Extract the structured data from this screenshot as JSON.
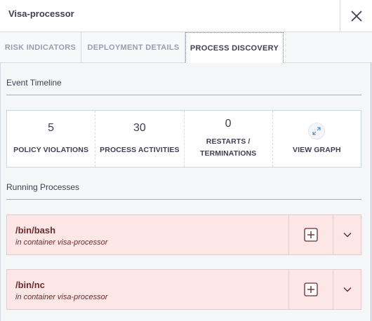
{
  "header": {
    "title": "Visa-processor",
    "close_icon": "close-icon"
  },
  "tabs": [
    {
      "label": "RISK INDICATORS",
      "active": false
    },
    {
      "label": "DEPLOYMENT DETAILS",
      "active": false
    },
    {
      "label": "PROCESS DISCOVERY",
      "active": true
    }
  ],
  "event_timeline": {
    "title": "Event Timeline",
    "stats": [
      {
        "value": "5",
        "label": "POLICY VIOLATIONS"
      },
      {
        "value": "30",
        "label": "PROCESS ACTIVITIES"
      },
      {
        "value": "0",
        "label_line1": "RESTARTS /",
        "label_line2": "TERMINATIONS"
      },
      {
        "icon": "expand-icon",
        "label": "VIEW GRAPH"
      }
    ]
  },
  "running_processes": {
    "title": "Running Processes",
    "items": [
      {
        "name": "/bin/bash",
        "container": "in container visa-processor"
      },
      {
        "name": "/bin/nc",
        "container": "in container visa-processor"
      }
    ]
  },
  "colors": {
    "process_bg": "#fde6e6",
    "process_text": "#6b2c30",
    "stats_border": "#c7d7ea"
  }
}
